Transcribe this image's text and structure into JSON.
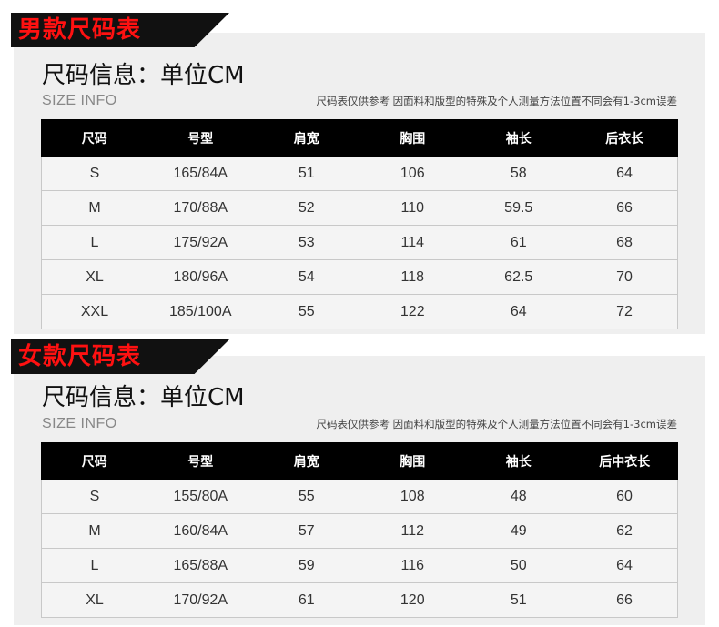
{
  "men": {
    "banner": "男款尺码表",
    "info_title": "尺码信息：单位CM",
    "info_sub": "SIZE INFO",
    "note": "尺码表仅供参考 因面料和版型的特殊及个人测量方法位置不同会有1-3cm误差",
    "headers": [
      "尺码",
      "号型",
      "肩宽",
      "胸围",
      "袖长",
      "后衣长"
    ],
    "rows": [
      [
        "S",
        "165/84A",
        "51",
        "106",
        "58",
        "64"
      ],
      [
        "M",
        "170/88A",
        "52",
        "110",
        "59.5",
        "66"
      ],
      [
        "L",
        "175/92A",
        "53",
        "114",
        "61",
        "68"
      ],
      [
        "XL",
        "180/96A",
        "54",
        "118",
        "62.5",
        "70"
      ],
      [
        "XXL",
        "185/100A",
        "55",
        "122",
        "64",
        "72"
      ]
    ]
  },
  "women": {
    "banner": "女款尺码表",
    "info_title": "尺码信息：单位CM",
    "info_sub": "SIZE INFO",
    "note": "尺码表仅供参考 因面料和版型的特殊及个人测量方法位置不同会有1-3cm误差",
    "headers": [
      "尺码",
      "号型",
      "肩宽",
      "胸围",
      "袖长",
      "后中衣长"
    ],
    "rows": [
      [
        "S",
        "155/80A",
        "55",
        "108",
        "48",
        "60"
      ],
      [
        "M",
        "160/84A",
        "57",
        "112",
        "49",
        "62"
      ],
      [
        "L",
        "165/88A",
        "59",
        "116",
        "50",
        "64"
      ],
      [
        "XL",
        "170/92A",
        "61",
        "120",
        "51",
        "66"
      ]
    ]
  },
  "colors": {
    "banner_bg": "#111111",
    "banner_text": "#ff1111",
    "header_bg": "#000000",
    "panel_bg": "#efefef"
  }
}
